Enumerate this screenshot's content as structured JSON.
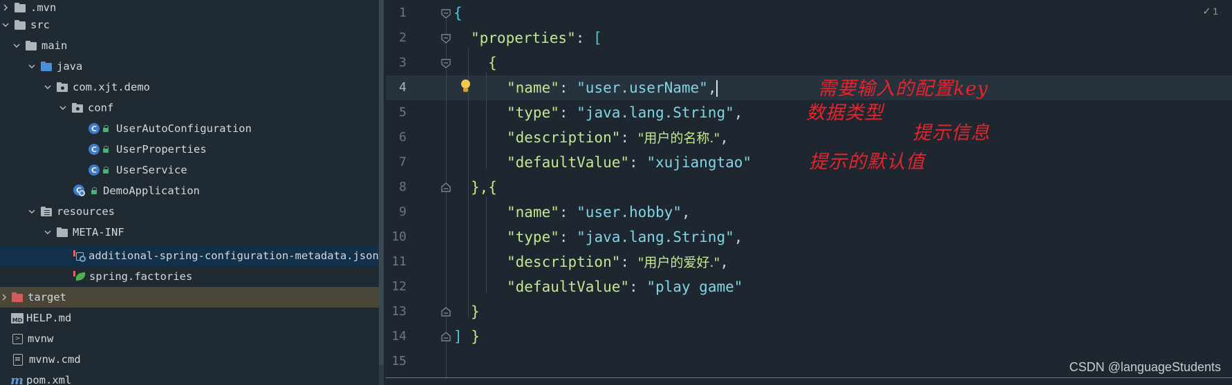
{
  "tree": {
    "items": [
      {
        "label": ".mvn",
        "icon": "folder-icon"
      },
      {
        "label": "src",
        "icon": "folder-icon"
      },
      {
        "label": "main",
        "icon": "folder-icon"
      },
      {
        "label": "java",
        "icon": "source-folder-icon"
      },
      {
        "label": "com.xjt.demo",
        "icon": "package-icon"
      },
      {
        "label": "conf",
        "icon": "package-icon"
      },
      {
        "label": "UserAutoConfiguration",
        "icon": "class-icon"
      },
      {
        "label": "UserProperties",
        "icon": "class-icon"
      },
      {
        "label": "UserService",
        "icon": "class-icon"
      },
      {
        "label": "DemoApplication",
        "icon": "spring-boot-app-icon"
      },
      {
        "label": "resources",
        "icon": "resources-folder-icon"
      },
      {
        "label": "META-INF",
        "icon": "folder-icon"
      },
      {
        "label": "additional-spring-configuration-metadata.json",
        "icon": "json-config-icon"
      },
      {
        "label": "spring.factories",
        "icon": "spring-leaf-icon"
      },
      {
        "label": "target",
        "icon": "excluded-folder-icon"
      },
      {
        "label": "HELP.md",
        "icon": "markdown-icon"
      },
      {
        "label": "mvnw",
        "icon": "terminal-icon"
      },
      {
        "label": "mvnw.cmd",
        "icon": "file-icon"
      },
      {
        "label": "pom.xml",
        "icon": "maven-icon"
      }
    ],
    "class_badge": "C"
  },
  "editor": {
    "line_numbers": [
      "1",
      "2",
      "3",
      "4",
      "5",
      "6",
      "7",
      "8",
      "9",
      "10",
      "11",
      "12",
      "13",
      "14",
      "15"
    ],
    "inspection": {
      "mark": "✓",
      "count": "1"
    },
    "code": {
      "l1_brace": "{",
      "l2_key": "\"properties\"",
      "l2_colon": ": ",
      "l2_bracket": "[",
      "l3_brace": "{",
      "l4_key": "\"name\"",
      "l4_colon": ": ",
      "l4_value": "\"user.userName\"",
      "l4_comma": ",",
      "l5_key": "\"type\"",
      "l5_colon": ": ",
      "l5_value": "\"java.lang.String\"",
      "l5_comma": ",",
      "l6_key": "\"description\"",
      "l6_colon": ": ",
      "l6_value": "\"用户的名称.\"",
      "l6_comma": ",",
      "l7_key": "\"defaultValue\"",
      "l7_colon": ": ",
      "l7_value": "\"xujiangtao\"",
      "l8_text": "},{",
      "l9_key": "\"name\"",
      "l9_colon": ": ",
      "l9_value": "\"user.hobby\"",
      "l9_comma": ",",
      "l10_key": "\"type\"",
      "l10_colon": ": ",
      "l10_value": "\"java.lang.String\"",
      "l10_comma": ",",
      "l11_key": "\"description\"",
      "l11_colon": ": ",
      "l11_value": "\"用户的爱好.\"",
      "l11_comma": ",",
      "l12_key": "\"defaultValue\"",
      "l12_colon": ": ",
      "l12_value": "\"play game\"",
      "l13_brace": "}",
      "l14_bracket": "]",
      "l14_brace": " }"
    },
    "annotations": {
      "name": "需要输入的配置key",
      "type": "数据类型",
      "description": "提示信息",
      "default": "提示的默认值"
    },
    "watermark": "CSDN @languageStudents",
    "colors": {
      "key": "#c3e88d",
      "string": "#7fd6e6",
      "annotation": "#e8232b",
      "bracket": "#4fc3d9"
    }
  }
}
